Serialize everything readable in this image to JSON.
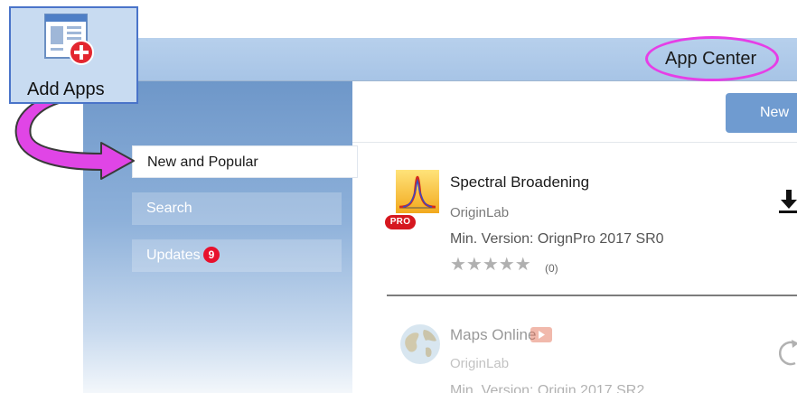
{
  "window": {
    "title": "App Center"
  },
  "toolbar": {
    "add_apps_label": "Add Apps",
    "new_button_label": "New"
  },
  "sidebar": {
    "items": [
      {
        "label": "New and Popular",
        "selected": true
      },
      {
        "label": "Search",
        "selected": false
      },
      {
        "label": "Updates",
        "selected": false,
        "badge": "9"
      }
    ]
  },
  "apps": [
    {
      "name": "Spectral Broadening",
      "author": "OriginLab",
      "min_version": "Min. Version: OrignPro 2017 SR0",
      "rating_stars": "★★★★★",
      "rating_count": "(0)",
      "badge": "PRO",
      "icon": "spectral-peak-icon",
      "action_icon": "download-icon"
    },
    {
      "name": "Maps Online",
      "author": "OriginLab",
      "min_version": "Min. Version: Origin 2017 SR2",
      "icon": "globe-icon",
      "action_icon": "refresh-icon",
      "video_icon": "video-icon"
    }
  ],
  "colors": {
    "highlight": "#e63ee6",
    "titlebar": "#b7d0ec",
    "sidebar": "#6e97c9",
    "badge": "#e8112d",
    "new_button": "#6f9bd0"
  }
}
